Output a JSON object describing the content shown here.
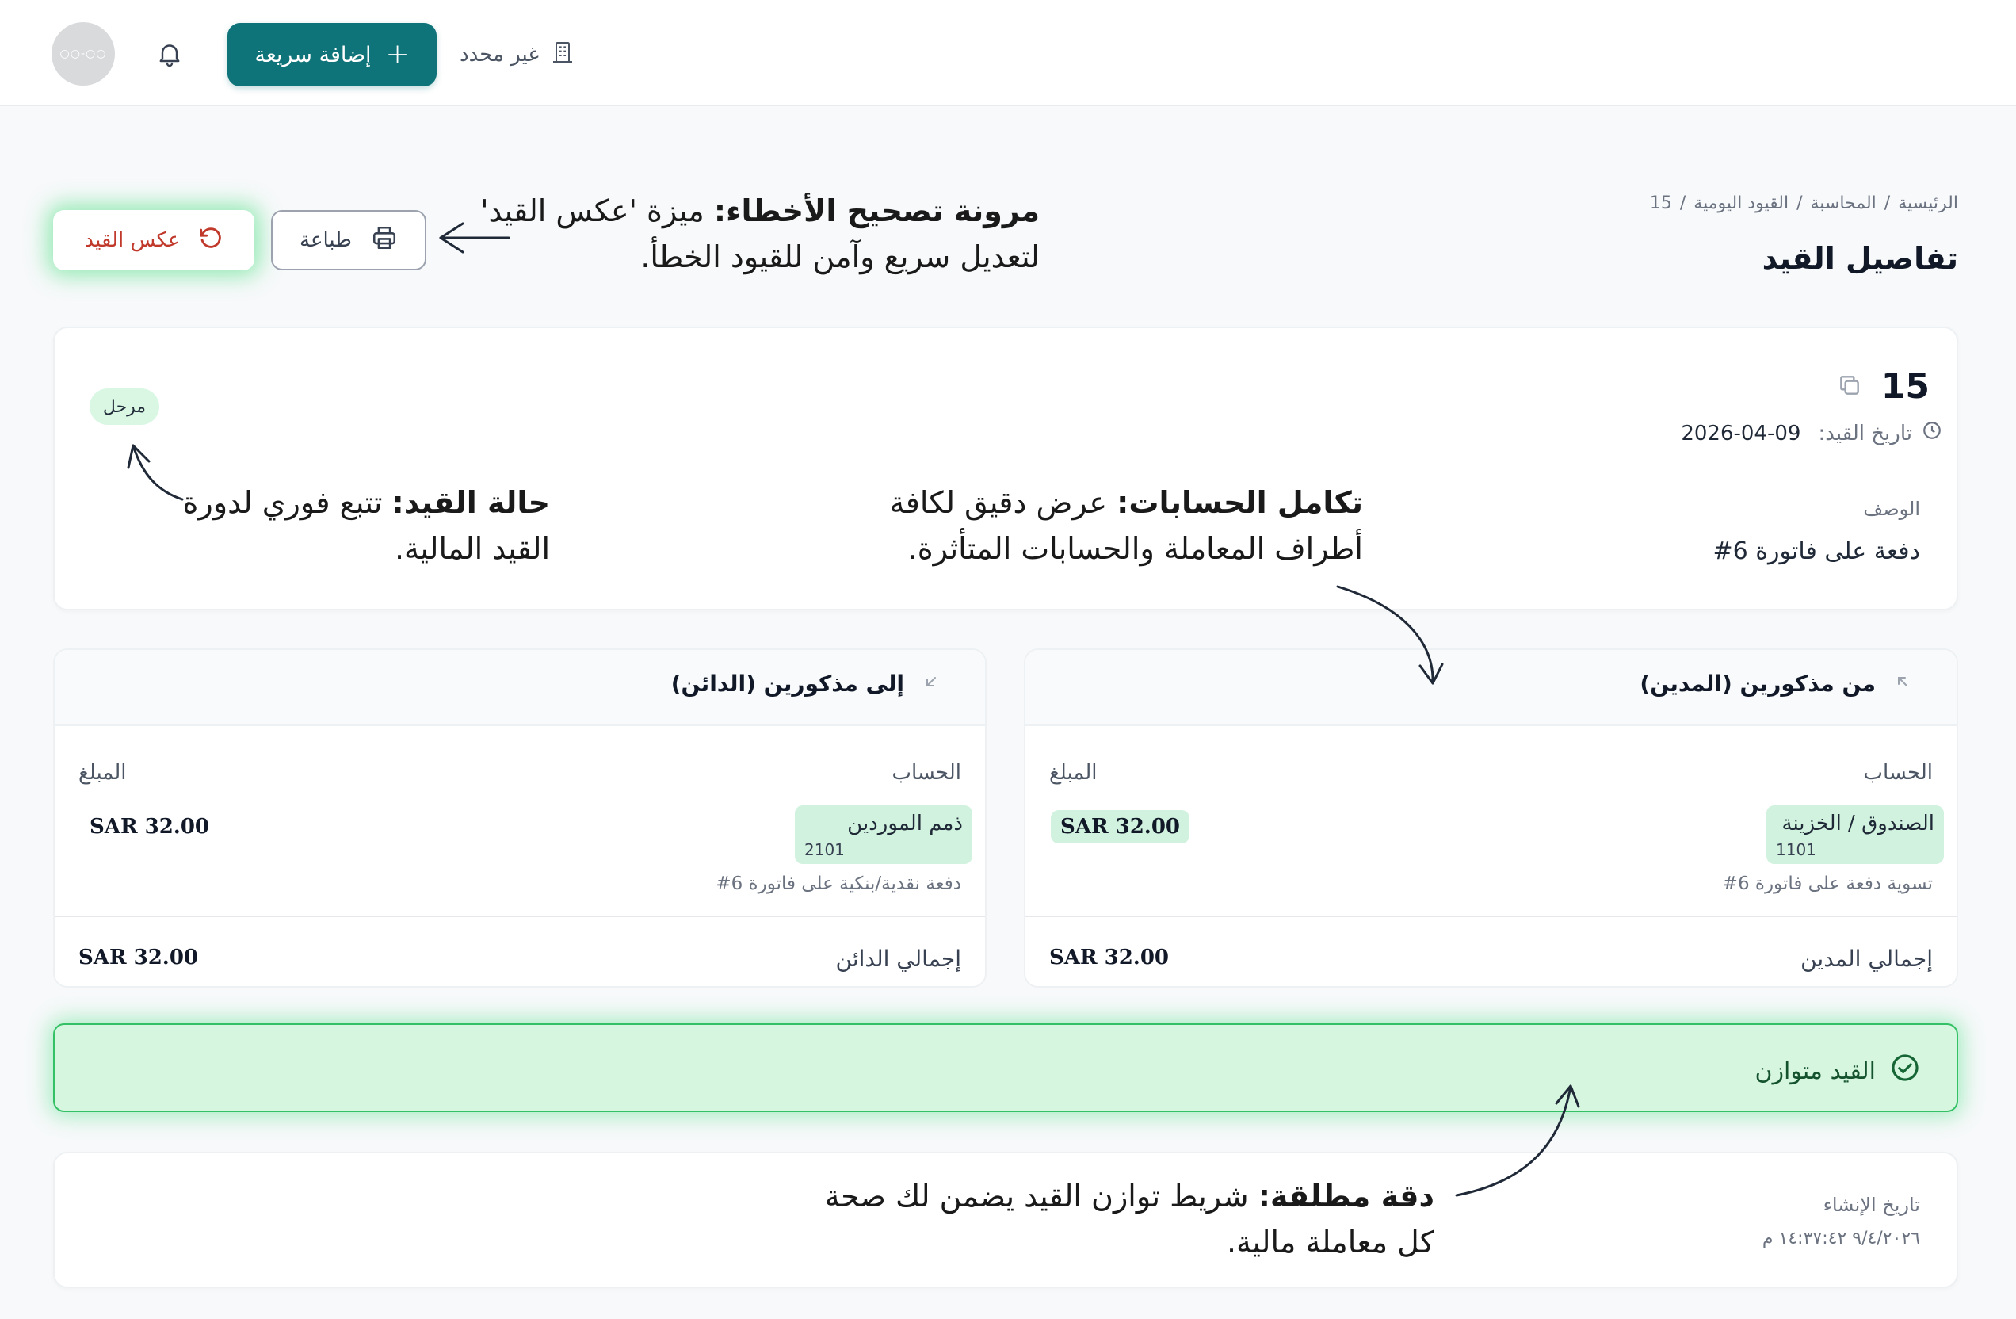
{
  "header": {
    "avatar_text": "○○-○○",
    "quick_add_label": "إضافة سريعة",
    "quick_add_icon": "+",
    "branch_label": "غير محدد"
  },
  "breadcrumb": {
    "items": [
      "الرئيسية",
      "المحاسبة",
      "القيود اليومية",
      "15"
    ],
    "separator": "/"
  },
  "page_title": "تفاصيل القيد",
  "actions": {
    "print_label": "طباعة",
    "reverse_label": "عكس القيد"
  },
  "entry": {
    "number": "15",
    "date_label": "تاريخ القيد:",
    "date_value": "2026-04-09",
    "description_label": "الوصف",
    "description_value": "دفعة على فاتورة 6#",
    "status": "مرحل"
  },
  "debit": {
    "title": "من مذكورين (المدين)",
    "col_account": "الحساب",
    "col_amount": "المبلغ",
    "account_name": "الصندوق / الخزينة",
    "account_code": "1101",
    "line_desc": "تسوية دفعة على فاتورة 6#",
    "amount": "SAR 32.00",
    "total_label": "إجمالي المدين",
    "total_amount": "SAR 32.00"
  },
  "credit": {
    "title": "إلى مذكورين (الدائن)",
    "col_account": "الحساب",
    "col_amount": "المبلغ",
    "account_name": "ذمم الموردين",
    "account_code": "2101",
    "line_desc": "دفعة نقدية/بنكية على فاتورة 6#",
    "amount": "SAR 32.00",
    "total_label": "إجمالي الدائن",
    "total_amount": "SAR 32.00"
  },
  "balance": {
    "text": "القيد متوازن"
  },
  "meta": {
    "created_label": "تاريخ الإنشاء",
    "created_value": "٩/٤/٢٠٢٦ ١٤:٣٧:٤٢ م"
  },
  "annotations": {
    "flex_title": "مرونة تصحيح الأخطاء:",
    "flex_body": "ميزة 'عكس القيد' لتعديل سريع وآمن للقيود الخطأ.",
    "accounts_title": "تكامل الحسابات:",
    "accounts_body": "عرض دقيق لكافة أطراف المعاملة والحسابات المتأثرة.",
    "status_title": "حالة القيد:",
    "status_body": "تتبع فوري لدورة القيد المالية.",
    "accuracy_title": "دقة مطلقة:",
    "accuracy_body": "شريط توازن القيد يضمن لك صحة كل معاملة مالية."
  },
  "colors": {
    "primary": "#0f7479",
    "danger": "#c0392b",
    "success_bg": "#d6f6e0",
    "success_border": "#34c064",
    "tag_bg": "#d1f2de"
  }
}
